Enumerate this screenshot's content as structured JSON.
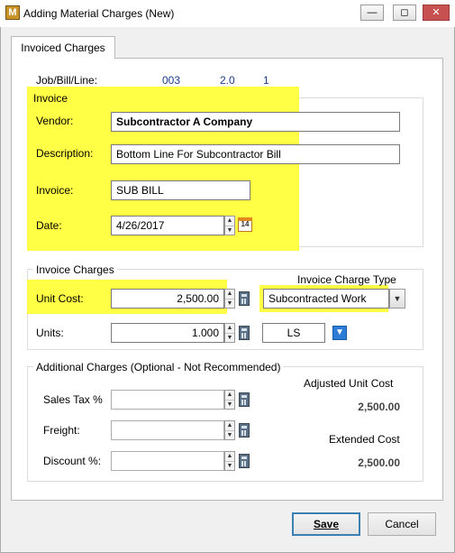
{
  "window": {
    "title": "Adding Material Charges  (New)",
    "app_icon_letter": "M",
    "minimize_glyph": "—",
    "maximize_glyph": "◻",
    "close_glyph": "✕"
  },
  "tab": {
    "label": "Invoiced Charges"
  },
  "job": {
    "label": "Job/Bill/Line:",
    "job": "003",
    "bill": "2.0",
    "line": "1"
  },
  "invoice": {
    "group_title": "Invoice",
    "vendor_label": "Vendor:",
    "vendor_value": "Subcontractor A Company",
    "description_label": "Description:",
    "description_value": "Bottom Line For Subcontractor Bill",
    "invoice_label": "Invoice:",
    "invoice_value": "SUB BILL",
    "date_label": "Date:",
    "date_value": "4/26/2017",
    "calendar_day": "14"
  },
  "charges": {
    "group_title": "Invoice Charges",
    "unit_cost_label": "Unit Cost:",
    "unit_cost_value": "2,500.00",
    "units_label": "Units:",
    "units_value": "1.000",
    "type_label": "Invoice Charge Type",
    "type_value": "Subcontracted Work",
    "uom_value": "LS"
  },
  "additional": {
    "group_title": "Additional Charges (Optional - Not Recommended)",
    "sales_tax_label": "Sales Tax %",
    "sales_tax_value": "",
    "freight_label": "Freight:",
    "freight_value": "",
    "discount_label": "Discount %:",
    "discount_value": "",
    "adjusted_label": "Adjusted Unit Cost",
    "adjusted_value": "2,500.00",
    "extended_label": "Extended Cost",
    "extended_value": "2,500.00"
  },
  "buttons": {
    "save_label": "Save",
    "cancel_label": "Cancel"
  },
  "colors": {
    "highlight": "#ffff46",
    "link_blue": "#1a3c8c",
    "accent": "#3c7fb1"
  }
}
